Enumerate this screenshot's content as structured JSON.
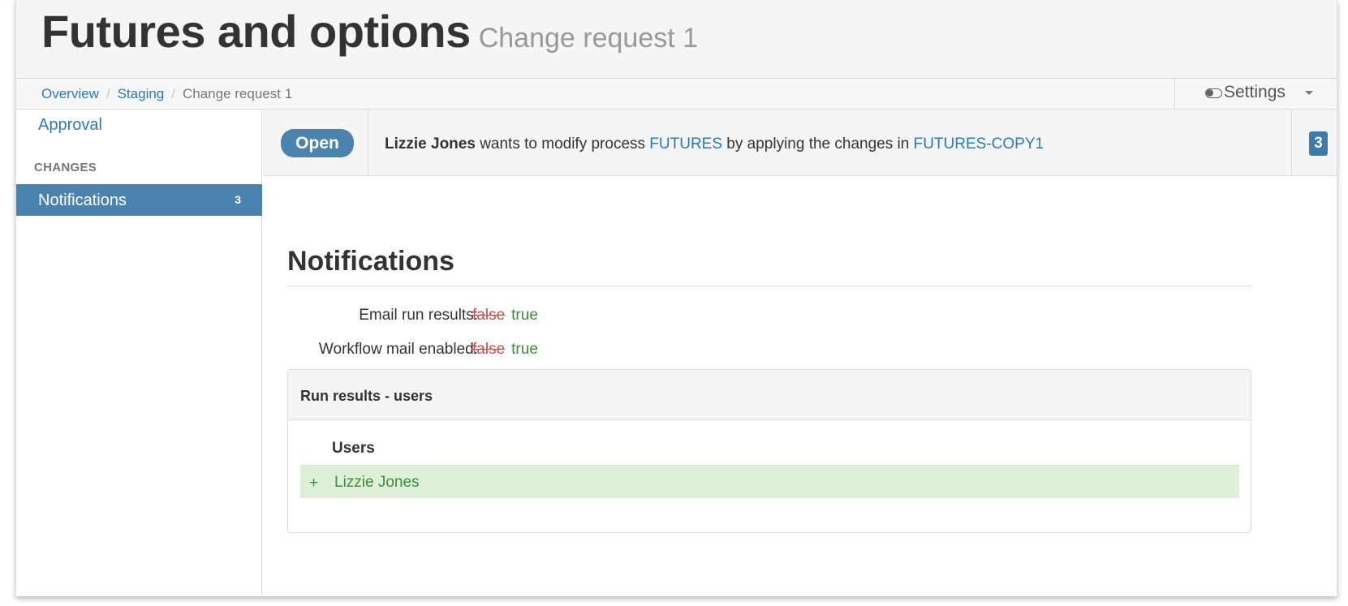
{
  "header": {
    "title": "Futures and options",
    "subtitle": "Change request 1"
  },
  "breadcrumb": {
    "items": [
      "Overview",
      "Staging"
    ],
    "current": "Change request 1"
  },
  "settings": {
    "label": "Settings",
    "icon": "toggle-icon"
  },
  "sidebar": {
    "approval_label": "Approval",
    "section_header": "CHANGES",
    "active_item": {
      "label": "Notifications",
      "count": "3"
    }
  },
  "status": {
    "badge": "Open",
    "user": "Lizzie Jones",
    "text_part1": " wants to modify process ",
    "process_link": "FUTURES",
    "text_part2": " by applying the changes in ",
    "source_link": "FUTURES-COPY1",
    "count": "3"
  },
  "main": {
    "section_title": "Notifications",
    "properties": [
      {
        "label": "Email run results:",
        "old": "false",
        "new": "true"
      },
      {
        "label": "Workflow mail enabled:",
        "old": "false",
        "new": "true"
      }
    ],
    "panel": {
      "title": "Run results - users",
      "column": "Users",
      "added": [
        {
          "symbol": "+",
          "name": "Lizzie Jones"
        }
      ]
    }
  },
  "colors": {
    "link": "#2a7ab8",
    "accent": "#4a84ae",
    "removed": "#c0504d",
    "added": "#3d8b3d",
    "added_bg": "#dff0d8"
  }
}
